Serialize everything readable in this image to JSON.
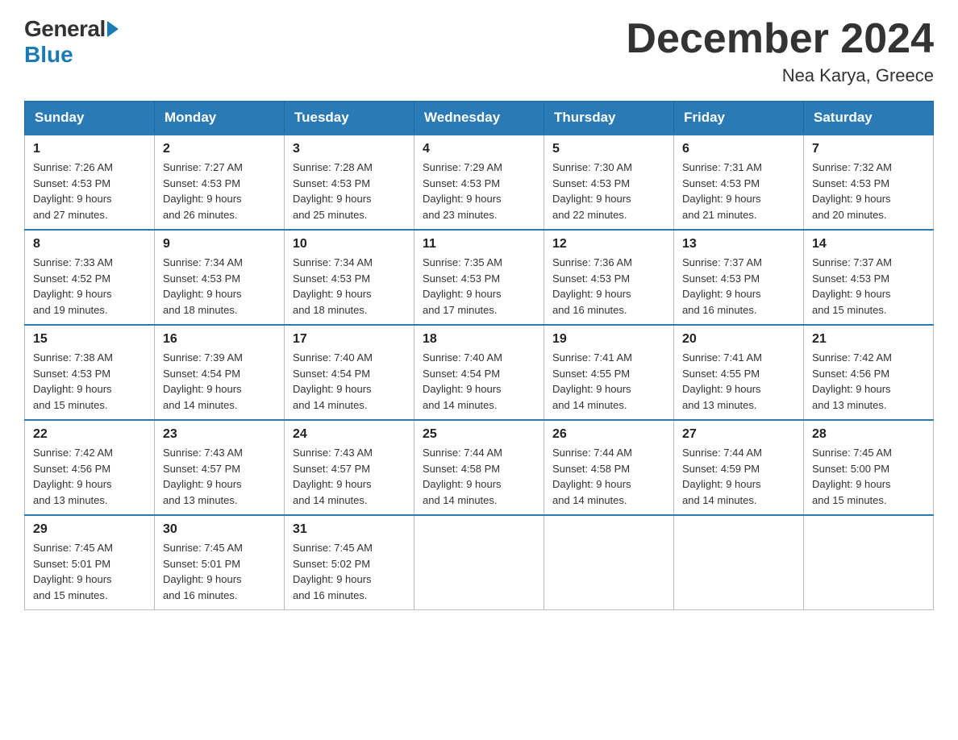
{
  "logo": {
    "general": "General",
    "blue": "Blue"
  },
  "title": "December 2024",
  "subtitle": "Nea Karya, Greece",
  "weekdays": [
    "Sunday",
    "Monday",
    "Tuesday",
    "Wednesday",
    "Thursday",
    "Friday",
    "Saturday"
  ],
  "weeks": [
    [
      {
        "day": "1",
        "sunrise": "7:26 AM",
        "sunset": "4:53 PM",
        "daylight": "9 hours and 27 minutes."
      },
      {
        "day": "2",
        "sunrise": "7:27 AM",
        "sunset": "4:53 PM",
        "daylight": "9 hours and 26 minutes."
      },
      {
        "day": "3",
        "sunrise": "7:28 AM",
        "sunset": "4:53 PM",
        "daylight": "9 hours and 25 minutes."
      },
      {
        "day": "4",
        "sunrise": "7:29 AM",
        "sunset": "4:53 PM",
        "daylight": "9 hours and 23 minutes."
      },
      {
        "day": "5",
        "sunrise": "7:30 AM",
        "sunset": "4:53 PM",
        "daylight": "9 hours and 22 minutes."
      },
      {
        "day": "6",
        "sunrise": "7:31 AM",
        "sunset": "4:53 PM",
        "daylight": "9 hours and 21 minutes."
      },
      {
        "day": "7",
        "sunrise": "7:32 AM",
        "sunset": "4:53 PM",
        "daylight": "9 hours and 20 minutes."
      }
    ],
    [
      {
        "day": "8",
        "sunrise": "7:33 AM",
        "sunset": "4:52 PM",
        "daylight": "9 hours and 19 minutes."
      },
      {
        "day": "9",
        "sunrise": "7:34 AM",
        "sunset": "4:53 PM",
        "daylight": "9 hours and 18 minutes."
      },
      {
        "day": "10",
        "sunrise": "7:34 AM",
        "sunset": "4:53 PM",
        "daylight": "9 hours and 18 minutes."
      },
      {
        "day": "11",
        "sunrise": "7:35 AM",
        "sunset": "4:53 PM",
        "daylight": "9 hours and 17 minutes."
      },
      {
        "day": "12",
        "sunrise": "7:36 AM",
        "sunset": "4:53 PM",
        "daylight": "9 hours and 16 minutes."
      },
      {
        "day": "13",
        "sunrise": "7:37 AM",
        "sunset": "4:53 PM",
        "daylight": "9 hours and 16 minutes."
      },
      {
        "day": "14",
        "sunrise": "7:37 AM",
        "sunset": "4:53 PM",
        "daylight": "9 hours and 15 minutes."
      }
    ],
    [
      {
        "day": "15",
        "sunrise": "7:38 AM",
        "sunset": "4:53 PM",
        "daylight": "9 hours and 15 minutes."
      },
      {
        "day": "16",
        "sunrise": "7:39 AM",
        "sunset": "4:54 PM",
        "daylight": "9 hours and 14 minutes."
      },
      {
        "day": "17",
        "sunrise": "7:40 AM",
        "sunset": "4:54 PM",
        "daylight": "9 hours and 14 minutes."
      },
      {
        "day": "18",
        "sunrise": "7:40 AM",
        "sunset": "4:54 PM",
        "daylight": "9 hours and 14 minutes."
      },
      {
        "day": "19",
        "sunrise": "7:41 AM",
        "sunset": "4:55 PM",
        "daylight": "9 hours and 14 minutes."
      },
      {
        "day": "20",
        "sunrise": "7:41 AM",
        "sunset": "4:55 PM",
        "daylight": "9 hours and 13 minutes."
      },
      {
        "day": "21",
        "sunrise": "7:42 AM",
        "sunset": "4:56 PM",
        "daylight": "9 hours and 13 minutes."
      }
    ],
    [
      {
        "day": "22",
        "sunrise": "7:42 AM",
        "sunset": "4:56 PM",
        "daylight": "9 hours and 13 minutes."
      },
      {
        "day": "23",
        "sunrise": "7:43 AM",
        "sunset": "4:57 PM",
        "daylight": "9 hours and 13 minutes."
      },
      {
        "day": "24",
        "sunrise": "7:43 AM",
        "sunset": "4:57 PM",
        "daylight": "9 hours and 14 minutes."
      },
      {
        "day": "25",
        "sunrise": "7:44 AM",
        "sunset": "4:58 PM",
        "daylight": "9 hours and 14 minutes."
      },
      {
        "day": "26",
        "sunrise": "7:44 AM",
        "sunset": "4:58 PM",
        "daylight": "9 hours and 14 minutes."
      },
      {
        "day": "27",
        "sunrise": "7:44 AM",
        "sunset": "4:59 PM",
        "daylight": "9 hours and 14 minutes."
      },
      {
        "day": "28",
        "sunrise": "7:45 AM",
        "sunset": "5:00 PM",
        "daylight": "9 hours and 15 minutes."
      }
    ],
    [
      {
        "day": "29",
        "sunrise": "7:45 AM",
        "sunset": "5:01 PM",
        "daylight": "9 hours and 15 minutes."
      },
      {
        "day": "30",
        "sunrise": "7:45 AM",
        "sunset": "5:01 PM",
        "daylight": "9 hours and 16 minutes."
      },
      {
        "day": "31",
        "sunrise": "7:45 AM",
        "sunset": "5:02 PM",
        "daylight": "9 hours and 16 minutes."
      },
      null,
      null,
      null,
      null
    ]
  ],
  "labels": {
    "sunrise": "Sunrise:",
    "sunset": "Sunset:",
    "daylight": "Daylight:"
  }
}
